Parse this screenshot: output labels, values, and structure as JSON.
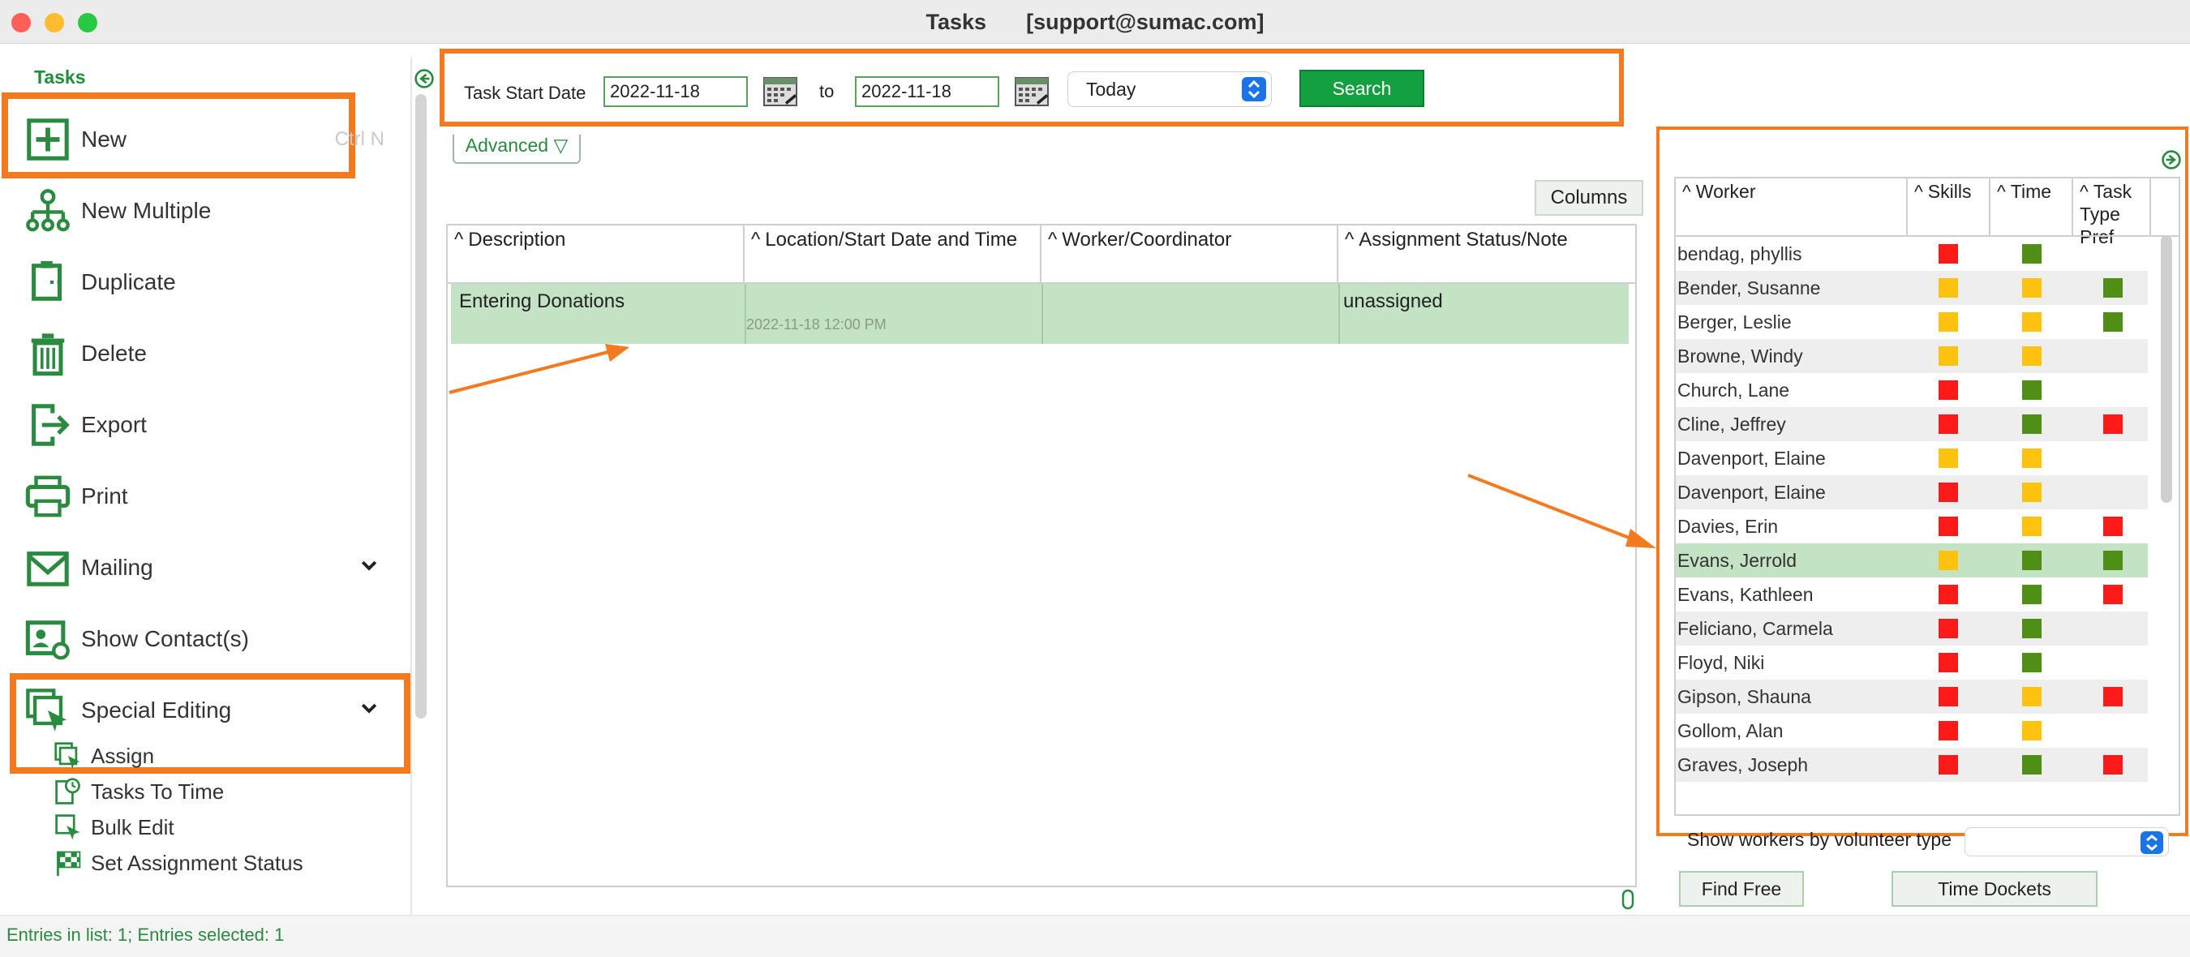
{
  "window": {
    "title": "Tasks",
    "user": "[support@sumac.com]"
  },
  "sidebar": {
    "header": "Tasks",
    "items": [
      {
        "label": "New",
        "shortcut": "Ctrl N",
        "icon": "plus-square-icon"
      },
      {
        "label": "New Multiple",
        "icon": "org-chart-icon"
      },
      {
        "label": "Duplicate",
        "icon": "duplicate-icon"
      },
      {
        "label": "Delete",
        "icon": "trash-icon"
      },
      {
        "label": "Export",
        "icon": "export-icon"
      },
      {
        "label": "Print",
        "icon": "printer-icon"
      },
      {
        "label": "Mailing",
        "icon": "envelope-icon"
      },
      {
        "label": "Show Contact(s)",
        "icon": "contact-card-icon"
      },
      {
        "label": "Special Editing",
        "icon": "special-editing-icon"
      }
    ],
    "sub_items": [
      {
        "label": "Assign",
        "icon": "assign-icon"
      },
      {
        "label": "Tasks To Time",
        "icon": "tasks-to-time-icon"
      },
      {
        "label": "Bulk Edit",
        "icon": "bulk-edit-icon"
      },
      {
        "label": "Set Assignment Status",
        "icon": "checkered-flag-icon"
      }
    ]
  },
  "search": {
    "label": "Task Start Date",
    "from": "2022-11-18",
    "to_label": "to",
    "to": "2022-11-18",
    "period": "Today",
    "button": "Search",
    "advanced": "Advanced ▽"
  },
  "main": {
    "columns_button": "Columns",
    "headers": [
      "Description",
      "Location/Start Date and Time",
      "Worker/Coordinator",
      "Assignment Status/Note"
    ],
    "rows": [
      {
        "description": "Entering Donations",
        "location": "",
        "start": "2022-11-18 12:00 PM",
        "worker": "",
        "status": "unassigned"
      }
    ]
  },
  "workers": {
    "headers": {
      "worker": "Worker",
      "skills": "Skills",
      "time": "Time",
      "task_line1": "Task",
      "task_line2": "Type Pref"
    },
    "colors": {
      "red": "#ff1a1a",
      "yellow": "#ffc20e",
      "green": "#4f8f16"
    },
    "rows": [
      {
        "name": "bendag, phyllis",
        "skills": "red",
        "time": "green",
        "pref": ""
      },
      {
        "name": "Bender, Susanne",
        "skills": "yellow",
        "time": "yellow",
        "pref": "green"
      },
      {
        "name": "Berger, Leslie",
        "skills": "yellow",
        "time": "yellow",
        "pref": "green"
      },
      {
        "name": "Browne, Windy",
        "skills": "yellow",
        "time": "yellow",
        "pref": ""
      },
      {
        "name": "Church, Lane",
        "skills": "red",
        "time": "green",
        "pref": ""
      },
      {
        "name": "Cline, Jeffrey",
        "skills": "red",
        "time": "green",
        "pref": "red"
      },
      {
        "name": "Davenport, Elaine",
        "skills": "yellow",
        "time": "yellow",
        "pref": ""
      },
      {
        "name": "Davenport, Elaine",
        "skills": "red",
        "time": "yellow",
        "pref": ""
      },
      {
        "name": "Davies, Erin",
        "skills": "red",
        "time": "yellow",
        "pref": "red"
      },
      {
        "name": "Evans, Jerrold",
        "skills": "yellow",
        "time": "green",
        "pref": "green",
        "selected": true
      },
      {
        "name": "Evans, Kathleen",
        "skills": "red",
        "time": "green",
        "pref": "red"
      },
      {
        "name": "Feliciano, Carmela",
        "skills": "red",
        "time": "green",
        "pref": ""
      },
      {
        "name": "Floyd, Niki",
        "skills": "red",
        "time": "green",
        "pref": ""
      },
      {
        "name": "Gipson, Shauna",
        "skills": "red",
        "time": "yellow",
        "pref": "red"
      },
      {
        "name": "Gollom, Alan",
        "skills": "red",
        "time": "yellow",
        "pref": ""
      },
      {
        "name": "Graves, Joseph",
        "skills": "red",
        "time": "green",
        "pref": "red"
      }
    ],
    "volunteer_type_label": "Show workers by volunteer type",
    "volunteer_type_value": "",
    "find_free": "Find Free",
    "time_dockets": "Time Dockets"
  },
  "status": "Entries in list: 1; Entries selected: 1",
  "accent": {
    "orange": "#f47a1f",
    "green": "#13a040"
  }
}
